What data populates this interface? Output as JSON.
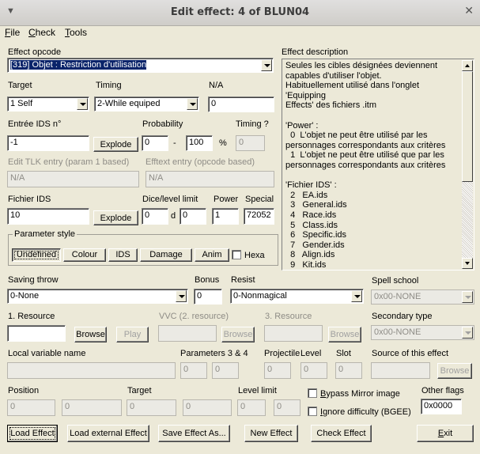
{
  "window": {
    "title": "Edit effect: 4 of BLUN04",
    "close_glyph": "✕",
    "menu_glyph": "▼"
  },
  "menu": {
    "file_u": "F",
    "file_rest": "ile",
    "check_u": "C",
    "check_rest": "heck",
    "tools_u": "T",
    "tools_rest": "ools"
  },
  "effect_opcode": {
    "label": "Effect opcode",
    "value": "[319] Objet : Restriction d'utilisation"
  },
  "target": {
    "label": "Target",
    "value": "1 Self"
  },
  "timing": {
    "label": "Timing",
    "value": "2-While equiped"
  },
  "na": {
    "label": "N/A",
    "value": "0"
  },
  "ids_entry": {
    "label": "Entrée IDS n°",
    "value": "-1",
    "explode_label": "Explode"
  },
  "probability": {
    "label": "Probability",
    "min": "0",
    "sep": "-",
    "max": "100",
    "unit": "%"
  },
  "timing_q": {
    "label": "Timing ?",
    "value": "0"
  },
  "tlk": {
    "label": "Edit TLK entry (param 1 based)",
    "value": "N/A"
  },
  "efftext": {
    "label": "Efftext entry (opcode based)",
    "value": "N/A"
  },
  "ids_file": {
    "label": "Fichier IDS",
    "value": "10",
    "explode_label": "Explode"
  },
  "dice": {
    "label": "Dice/level limit",
    "a": "0",
    "d": "d",
    "b": "0"
  },
  "power": {
    "label": "Power",
    "value": "1"
  },
  "special": {
    "label": "Special",
    "value": "72052"
  },
  "param_style": {
    "legend": "Parameter style",
    "buttons": [
      "Undefined",
      "Colour",
      "IDS",
      "Damage",
      "Anim"
    ],
    "hexa": "Hexa"
  },
  "description": {
    "label": "Effect description",
    "text": "Seules les cibles désignées deviennent\ncapables d'utiliser l'objet.\nHabituellement utilisé dans l'onglet 'Equipping\nEffects' des fichiers .itm\n\n'Power' :\n  0  L'objet ne peut être utilisé par les\npersonnages correspondants aux critères\n  1  L'objet ne peut être utilisé que par les\npersonnages correspondants aux critères\n\n'Fichier IDS' :\n  2   EA.ids\n  3   General.ids\n  4   Race.ids\n  5   Class.ids\n  6   Specific.ids\n  7   Gender.ids\n  8   Align.ids\n  9   Kit.ids"
  },
  "saving_throw": {
    "label": "Saving throw",
    "value": "0-None"
  },
  "bonus": {
    "label": "Bonus",
    "value": "0"
  },
  "resist": {
    "label": "Resist",
    "value": "0-Nonmagical"
  },
  "spell_school": {
    "label": "Spell school",
    "value": "0x00-NONE"
  },
  "resource1": {
    "label": "1. Resource",
    "value": "",
    "browse": "Browse",
    "play": "Play"
  },
  "resource2": {
    "label": "VVC (2. resource)",
    "browse": "Browse"
  },
  "resource3": {
    "label": "3. Resource",
    "browse": "Browse"
  },
  "secondary_type": {
    "label": "Secondary type",
    "value": "0x00-NONE"
  },
  "local_var": {
    "label": "Local variable name"
  },
  "params34": {
    "label": "Parameters 3 & 4",
    "p3": "0",
    "p4": "0"
  },
  "projectile": {
    "label": "Projectile",
    "value": "0"
  },
  "level": {
    "label": "Level",
    "value": "0"
  },
  "slot": {
    "label": "Slot",
    "value": "0"
  },
  "source": {
    "label": "Source of this effect",
    "browse": "Browse"
  },
  "position": {
    "label": "Position",
    "x": "0",
    "y": "0"
  },
  "target_pos": {
    "label": "Target",
    "x": "0",
    "y": "0"
  },
  "level_limit": {
    "label": "Level limit",
    "a": "0",
    "b": "0"
  },
  "bypass_mirror": {
    "u": "B",
    "rest": "ypass Mirror image"
  },
  "ignore_difficulty": {
    "u": "I",
    "rest": "gnore difficulty (BGEE)"
  },
  "other_flags": {
    "label": "Other flags",
    "value": "0x0000"
  },
  "footer": {
    "load_effect": "Load Effect",
    "load_external": "Load external Effect",
    "save_as": "Save Effect As...",
    "new_effect": "New Effect",
    "check_effect": "Check Effect",
    "exit_u": "E",
    "exit_rest": "xit"
  }
}
